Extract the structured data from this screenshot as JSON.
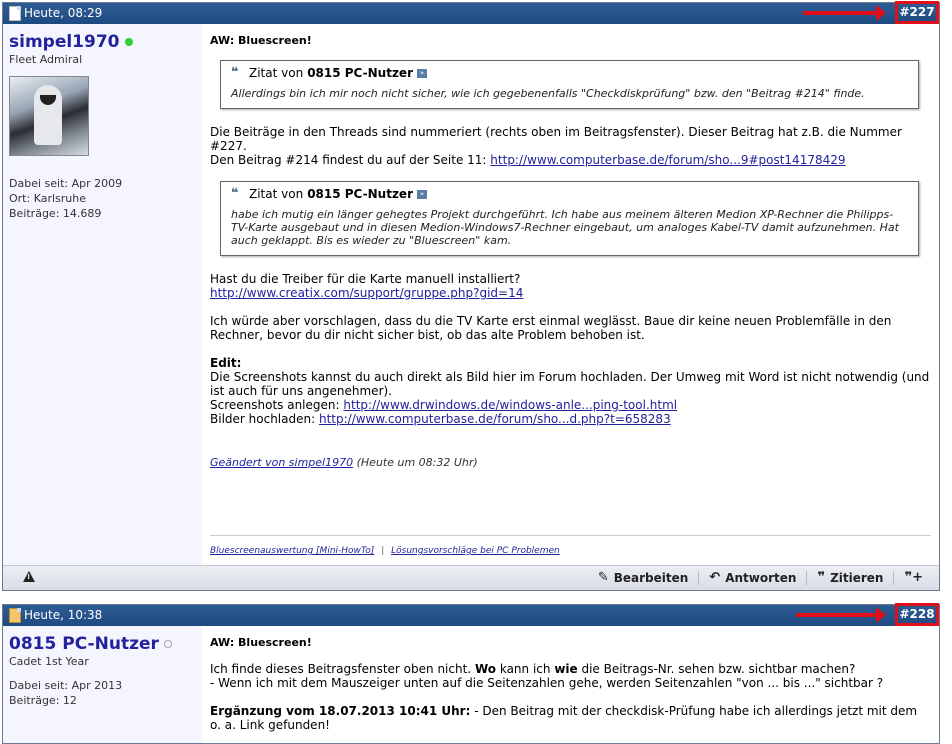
{
  "posts": [
    {
      "date": "Heute, 08:29",
      "number": "#227",
      "user": {
        "name": "simpel1970",
        "status": "online",
        "title": "Fleet Admiral",
        "joined": "Dabei seit: Apr 2009",
        "location": "Ort: Karlsruhe",
        "posts": "Beiträge: 14.689"
      },
      "title": "AW: Bluescreen!",
      "quote1": {
        "prefix": "Zitat von",
        "user": "0815 PC-Nutzer",
        "text": "Allerdings bin ich mir noch nicht sicher, wie ich gegebenenfalls \"Checkdiskprüfung\" bzw. den \"Beitrag #214\" finde."
      },
      "p1_line1": "Die Beiträge in den Threads sind nummeriert (rechts oben im Beitragsfenster). Dieser Beitrag hat z.B. die Nummer #227.",
      "p1_line2": "Den Beitrag #214 findest du auf der Seite 11:",
      "p1_link": "http://www.computerbase.de/forum/sho...9#post14178429",
      "quote2": {
        "prefix": "Zitat von",
        "user": "0815 PC-Nutzer",
        "text": "habe ich mutig ein länger gehegtes Projekt durchgeführt. Ich habe aus meinem älteren Medion XP-Rechner die Philipps-TV-Karte ausgebaut und in diesen Medion-Windows7-Rechner eingebaut, um analoges Kabel-TV damit aufzunehmen. Hat auch geklappt. Bis es wieder zu \"Bluescreen\" kam."
      },
      "p2_line1": "Hast du die Treiber für die Karte manuell installiert?",
      "p2_link": "http://www.creatix.com/support/gruppe.php?gid=14",
      "p3": "Ich würde aber vorschlagen, dass du die TV Karte erst einmal weglässt. Baue dir keine neuen Problemfälle in den Rechner, bevor du dir nicht sicher bist, ob das alte Problem behoben ist.",
      "edit_label": "Edit:",
      "edit_text": "Die Screenshots kannst du auch direkt als Bild hier im Forum hochladen. Der Umweg mit Word ist nicht notwendig (und ist auch für uns angenehmer).",
      "edit_line2_label": "Screenshots anlegen:",
      "edit_line2_link": "http://www.drwindows.de/windows-anle...ping-tool.html",
      "edit_line3_label": "Bilder hochladen:",
      "edit_line3_link": "http://www.computerbase.de/forum/sho...d.php?t=658283",
      "edited_link": "Geändert von simpel1970",
      "edited_time": "(Heute um 08:32 Uhr)",
      "sig_link1": "Bluescreenauswertung [Mini-HowTo]",
      "sig_sep": "|",
      "sig_link2": "Lösungsvorschläge bei PC Problemen",
      "actions": {
        "edit": "Bearbeiten",
        "reply": "Antworten",
        "quote": "Zitieren"
      }
    },
    {
      "date": "Heute, 10:38",
      "number": "#228",
      "user": {
        "name": "0815 PC-Nutzer",
        "status": "offline",
        "title": "Cadet 1st Year",
        "joined": "Dabei seit: Apr 2013",
        "posts": "Beiträge: 12"
      },
      "title": "AW: Bluescreen!",
      "l1_a": "Ich finde dieses Beitragsfenster oben nicht.",
      "l1_b": "Wo",
      "l1_c": "kann ich",
      "l1_d": "wie",
      "l1_e": "die Beitrags-Nr. sehen bzw. sichtbar machen?",
      "l2": "- Wenn ich mit dem Mauszeiger unten auf die Seitenzahlen gehe, werden Seitenzahlen \"von ... bis ...\" sichtbar ?",
      "l3_bold": "Ergänzung vom 18.07.2013 10:41 Uhr:",
      "l3_text": "- Den Beitrag mit der checkdisk-Prüfung habe ich allerdings jetzt mit dem o. a. Link gefunden!"
    }
  ],
  "colors": {
    "header": "#1e4a82",
    "highlight": "#e0101a",
    "link": "#22229c",
    "online": "#33cc33"
  },
  "icons": [
    "document-icon",
    "warning-icon",
    "pencil-icon",
    "reply-icon",
    "quote-icon",
    "multiquote-icon",
    "quote-mark-icon",
    "jump-to-post-icon"
  ]
}
